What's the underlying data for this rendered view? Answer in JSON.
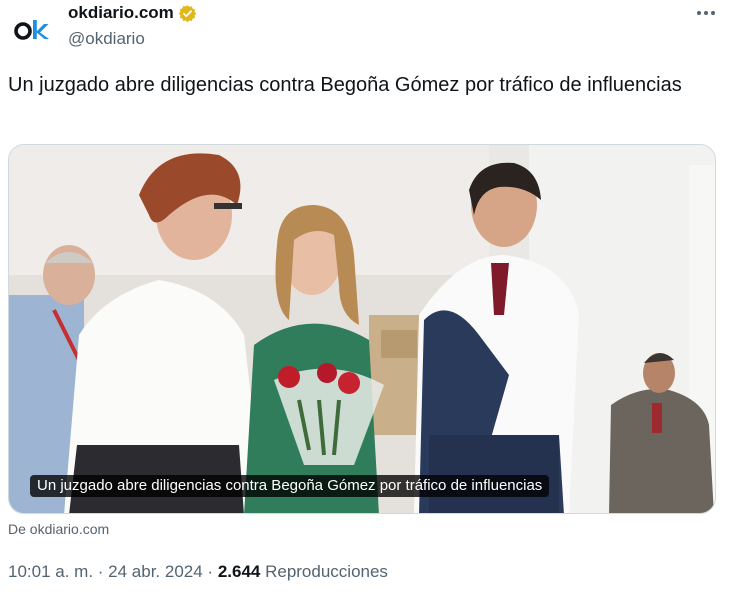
{
  "author": {
    "display_name": "okdiario.com",
    "handle": "@okdiario",
    "verified_color": "#e2b719",
    "logo_text": "ok",
    "logo_colors": {
      "o": "#0f1419",
      "k": "#1d8fe0"
    }
  },
  "menu": {
    "icon": "more-horizontal-icon"
  },
  "tweet": {
    "text": "Un juzgado abre diligencias contra Begoña Gómez por tráfico de influencias"
  },
  "media": {
    "caption": "Un juzgado abre diligencias contra Begoña Gómez por tráfico de influencias",
    "source": "De okdiario.com"
  },
  "meta": {
    "time": "10:01 a. m.",
    "sep1": " · ",
    "date": "24 abr. 2024",
    "sep2": " · ",
    "views": "2.644",
    "views_label": " Reproducciones"
  },
  "colors": {
    "text_primary": "#0f1419",
    "text_secondary": "#536471",
    "border": "#cfd9de"
  }
}
